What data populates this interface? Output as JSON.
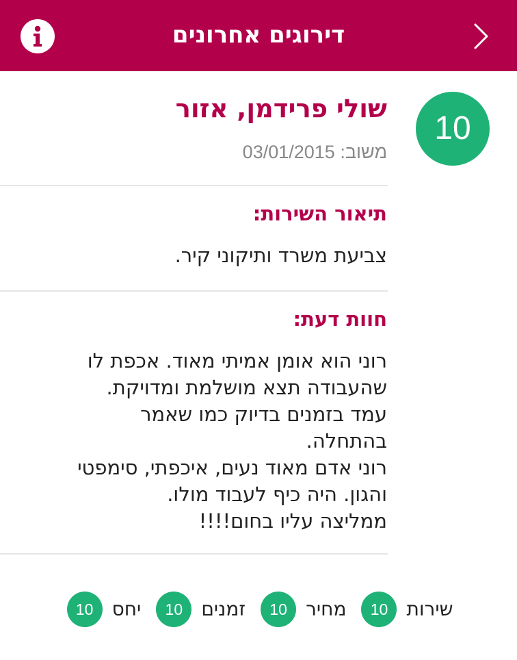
{
  "header": {
    "title": "דירוגים אחרונים",
    "background_color": "#b3004b",
    "info_icon": "info-icon",
    "back_icon": "chevron-right-icon"
  },
  "review": {
    "rating": "10",
    "rating_color": "#1fb277",
    "reviewer": "שולי פרידמן, אזור",
    "date_label": "משוב:",
    "date_value": "03/01/2015",
    "service_title": "תיאור השירות:",
    "service_text": "צביעת משרד ותיקוני קיר.",
    "opinion_title": "חוות דעת:",
    "opinion_text": "רוני הוא אומן אמיתי מאוד. אכפת לו\nשהעבודה תצא מושלמת ומדויקת.\nעמד בזמנים בדיוק כמו שאמר\nבהתחלה.\nרוני אדם מאוד נעים, איכפתי, סימפטי\nוהגון. היה כיף לעבוד מולו.\nממליצה עליו בחום!!!!"
  },
  "scores": [
    {
      "label": "שירות",
      "value": "10"
    },
    {
      "label": "מחיר",
      "value": "10"
    },
    {
      "label": "זמנים",
      "value": "10"
    },
    {
      "label": "יחס",
      "value": "10"
    }
  ]
}
